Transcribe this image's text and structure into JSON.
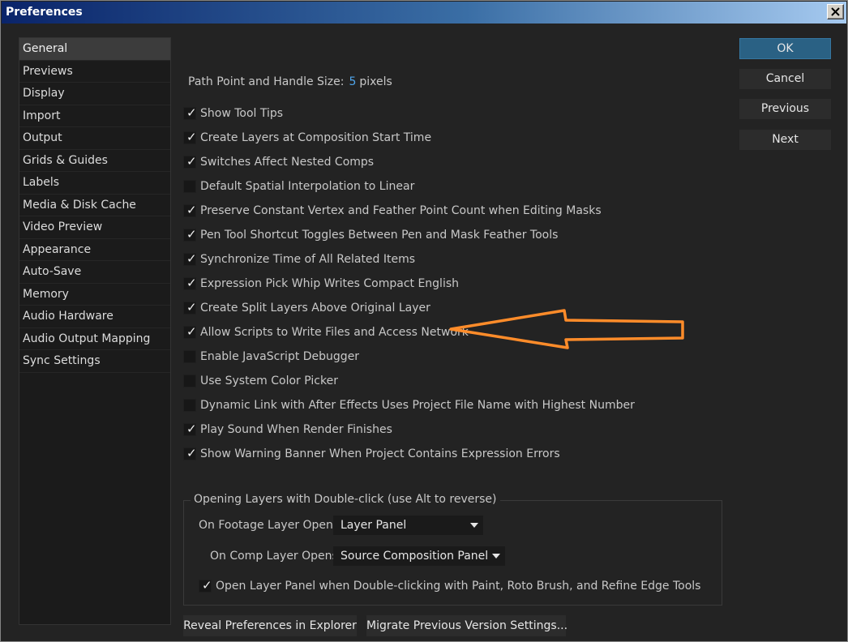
{
  "window": {
    "title": "Preferences"
  },
  "sidebar": {
    "items": [
      {
        "label": "General",
        "selected": true
      },
      {
        "label": "Previews"
      },
      {
        "label": "Display"
      },
      {
        "label": "Import"
      },
      {
        "label": "Output"
      },
      {
        "label": "Grids & Guides"
      },
      {
        "label": "Labels"
      },
      {
        "label": "Media & Disk Cache"
      },
      {
        "label": "Video Preview"
      },
      {
        "label": "Appearance"
      },
      {
        "label": "Auto-Save"
      },
      {
        "label": "Memory"
      },
      {
        "label": "Audio Hardware"
      },
      {
        "label": "Audio Output Mapping"
      },
      {
        "label": "Sync Settings"
      }
    ]
  },
  "general": {
    "path_point_label": "Path Point and Handle Size:",
    "path_point_value": "5",
    "path_point_unit": "pixels",
    "options": [
      {
        "label": "Show Tool Tips",
        "checked": true
      },
      {
        "label": "Create Layers at Composition Start Time",
        "checked": true
      },
      {
        "label": "Switches Affect Nested Comps",
        "checked": true
      },
      {
        "label": "Default Spatial Interpolation to Linear",
        "checked": false
      },
      {
        "label": "Preserve Constant Vertex and Feather Point Count when Editing Masks",
        "checked": true
      },
      {
        "label": "Pen Tool Shortcut Toggles Between Pen and Mask Feather Tools",
        "checked": true
      },
      {
        "label": "Synchronize Time of All Related Items",
        "checked": true
      },
      {
        "label": "Expression Pick Whip Writes Compact English",
        "checked": true
      },
      {
        "label": "Create Split Layers Above Original Layer",
        "checked": true
      },
      {
        "label": "Allow Scripts to Write Files and Access Network",
        "checked": true
      },
      {
        "label": "Enable JavaScript Debugger",
        "checked": false
      },
      {
        "label": "Use System Color Picker",
        "checked": false
      },
      {
        "label": "Dynamic Link with After Effects Uses Project File Name with Highest Number",
        "checked": false
      },
      {
        "label": "Play Sound When Render Finishes",
        "checked": true
      },
      {
        "label": "Show Warning Banner When Project Contains Expression Errors",
        "checked": true
      }
    ],
    "double_click": {
      "title": "Opening Layers with Double-click (use Alt to reverse)",
      "footage_label": "On Footage Layer Opens:",
      "footage_value": "Layer Panel",
      "comp_label": "On Comp Layer Opens:",
      "comp_value": "Source Composition Panel",
      "open_layer_panel_label": "Open Layer Panel when Double-clicking with Paint, Roto Brush, and Refine Edge Tools",
      "open_layer_panel_checked": true
    },
    "reveal_button": "Reveal Preferences in Explorer",
    "migrate_button": "Migrate Previous Version Settings..."
  },
  "buttons": {
    "ok": "OK",
    "cancel": "Cancel",
    "previous": "Previous",
    "next": "Next"
  },
  "tick_glyph": "✓",
  "annotation": {
    "arrow_color": "#ff8c2a"
  }
}
